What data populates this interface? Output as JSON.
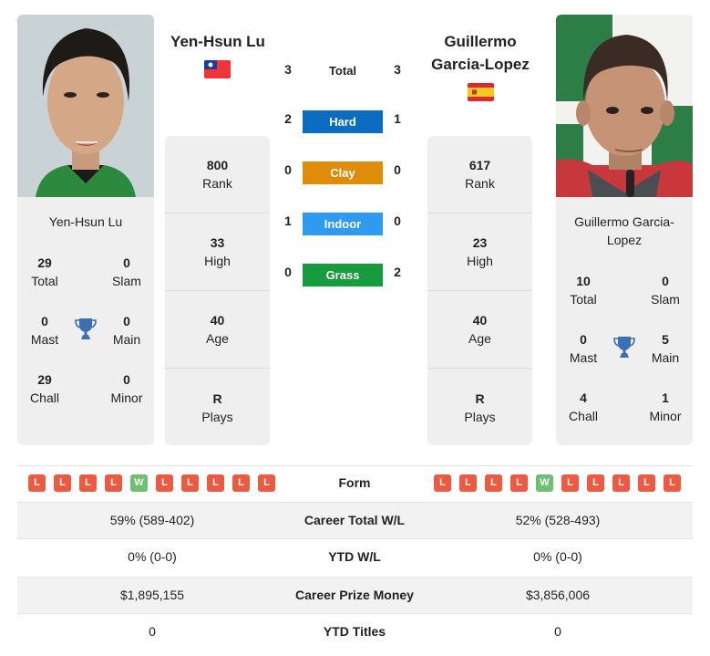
{
  "player1": {
    "name": "Yen-Hsun Lu",
    "card_name": "Yen-Hsun Lu",
    "country": "Taiwan",
    "flag_icon": "taiwan-flag-icon",
    "titles": {
      "total": {
        "value": "29",
        "label": "Total"
      },
      "slam": {
        "value": "0",
        "label": "Slam"
      },
      "mast": {
        "value": "0",
        "label": "Mast"
      },
      "main": {
        "value": "0",
        "label": "Main"
      },
      "chall": {
        "value": "29",
        "label": "Chall"
      },
      "minor": {
        "value": "0",
        "label": "Minor"
      }
    },
    "stats": [
      {
        "value": "800",
        "label": "Rank"
      },
      {
        "value": "33",
        "label": "High"
      },
      {
        "value": "40",
        "label": "Age"
      },
      {
        "value": "R",
        "label": "Plays"
      }
    ],
    "form": [
      "L",
      "L",
      "L",
      "L",
      "W",
      "L",
      "L",
      "L",
      "L",
      "L"
    ]
  },
  "player2": {
    "name": "Guillermo Garcia-Lopez",
    "name_line1": "Guillermo",
    "name_line2": "Garcia-Lopez",
    "card_name_line1": "Guillermo Garcia-",
    "card_name_line2": "Lopez",
    "country": "Spain",
    "flag_icon": "spain-flag-icon",
    "titles": {
      "total": {
        "value": "10",
        "label": "Total"
      },
      "slam": {
        "value": "0",
        "label": "Slam"
      },
      "mast": {
        "value": "0",
        "label": "Mast"
      },
      "main": {
        "value": "5",
        "label": "Main"
      },
      "chall": {
        "value": "4",
        "label": "Chall"
      },
      "minor": {
        "value": "1",
        "label": "Minor"
      }
    },
    "stats": [
      {
        "value": "617",
        "label": "Rank"
      },
      {
        "value": "23",
        "label": "High"
      },
      {
        "value": "40",
        "label": "Age"
      },
      {
        "value": "R",
        "label": "Plays"
      }
    ],
    "form": [
      "L",
      "L",
      "L",
      "L",
      "W",
      "L",
      "L",
      "L",
      "L",
      "L"
    ]
  },
  "h2h": [
    {
      "label": "Total",
      "p1": "3",
      "p2": "3",
      "color": ""
    },
    {
      "label": "Hard",
      "p1": "2",
      "p2": "1",
      "color": "#0b6cc0"
    },
    {
      "label": "Clay",
      "p1": "0",
      "p2": "0",
      "color": "#e08c0b"
    },
    {
      "label": "Indoor",
      "p1": "1",
      "p2": "0",
      "color": "#2e9bf0"
    },
    {
      "label": "Grass",
      "p1": "0",
      "p2": "2",
      "color": "#169c3e"
    }
  ],
  "form_label": "Form",
  "comparison": [
    {
      "label": "Career Total W/L",
      "p1": "59% (589-402)",
      "p2": "52% (528-493)"
    },
    {
      "label": "YTD W/L",
      "p1": "0% (0-0)",
      "p2": "0% (0-0)"
    },
    {
      "label": "Career Prize Money",
      "p1": "$1,895,155",
      "p2": "$3,856,006"
    },
    {
      "label": "YTD Titles",
      "p1": "0",
      "p2": "0"
    }
  ],
  "colors": {
    "loss": "#ec5a42",
    "win": "#6fbf73",
    "trophy": "#3d6fb6"
  }
}
